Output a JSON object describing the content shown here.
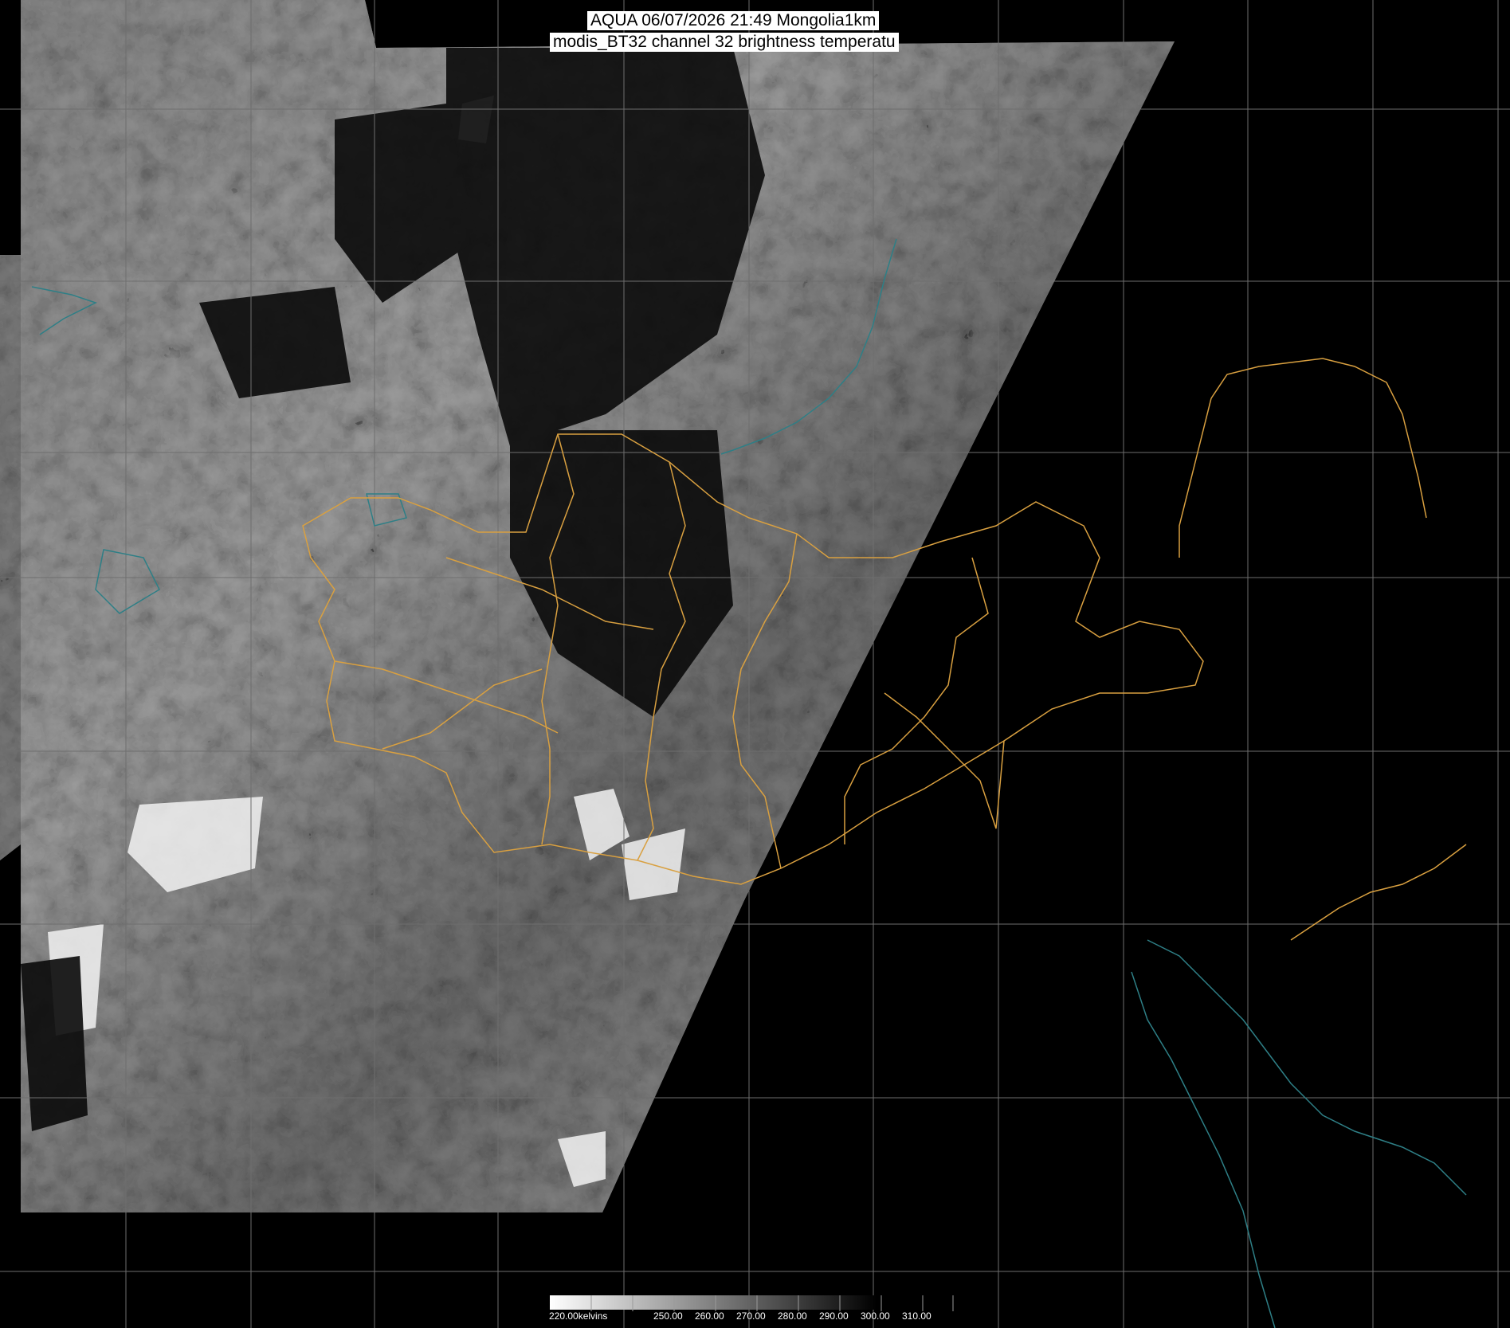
{
  "header": {
    "line1": "AQUA 06/07/2026 21:49 Mongolia1km",
    "line2": "modis_BT32 channel 32 brightness temperatu"
  },
  "colorbar": {
    "unit_label": "220.00kelvins",
    "ticks": [
      "250.00",
      "260.00",
      "270.00",
      "280.00",
      "290.00",
      "300.00",
      "310.00"
    ]
  },
  "colors": {
    "background": "#000000",
    "grid": "#6e6e6e",
    "borders": "#d9a040",
    "coast": "#2e7f86"
  }
}
